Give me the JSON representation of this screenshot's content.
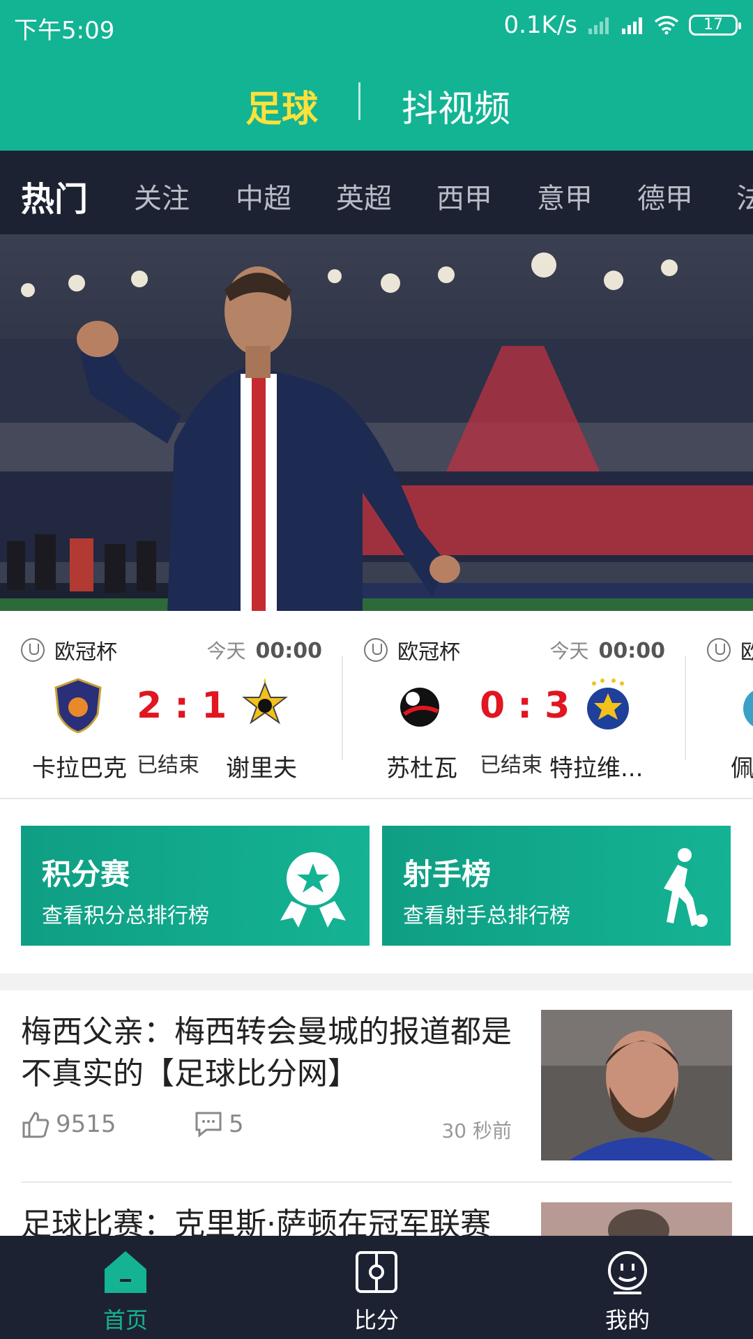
{
  "status_bar": {
    "time": "下午5:09",
    "speed": "0.1K/s",
    "battery": "17"
  },
  "top_tabs": {
    "active": "足球",
    "inactive": "抖视频"
  },
  "categories": [
    "热门",
    "关注",
    "中超",
    "英超",
    "西甲",
    "意甲",
    "德甲",
    "法"
  ],
  "matches": [
    {
      "league": "欧冠杯",
      "day": "今天",
      "time": "00:00",
      "home": "卡拉巴克",
      "away": "谢里夫",
      "score": "2 : 1",
      "status": "已结束"
    },
    {
      "league": "欧冠杯",
      "day": "今天",
      "time": "00:00",
      "home": "苏杜瓦",
      "away": "特拉维...",
      "score": "0 : 3",
      "status": "已结束"
    },
    {
      "league": "欧",
      "home": "佩"
    }
  ],
  "features": [
    {
      "title": "积分赛",
      "subtitle": "查看积分总排行榜",
      "icon": "award-star-icon"
    },
    {
      "title": "射手榜",
      "subtitle": "查看射手总排行榜",
      "icon": "soccer-player-icon"
    }
  ],
  "news": [
    {
      "title": "梅西父亲：梅西转会曼城的报道都是不真实的【足球比分网】",
      "likes": "9515",
      "comments": "5",
      "time": "30 秒前"
    },
    {
      "title": "足球比赛：克里斯·萨顿在冠军联赛"
    }
  ],
  "bottom_nav": [
    {
      "label": "首页",
      "icon": "home-icon"
    },
    {
      "label": "比分",
      "icon": "scoreboard-icon"
    },
    {
      "label": "我的",
      "icon": "profile-icon"
    }
  ],
  "colors": {
    "brand": "#12b493",
    "dark": "#1d2232",
    "score_red": "#e01620",
    "active_tab": "#ffe13a"
  }
}
